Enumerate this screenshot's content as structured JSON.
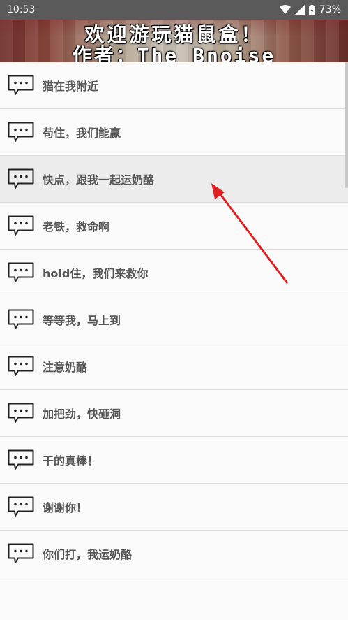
{
  "status_bar": {
    "time": "10:53",
    "battery": "73%",
    "icons": [
      "wifi-icon",
      "signal-icon",
      "battery-icon"
    ]
  },
  "banner": {
    "line1": "欢迎游玩猫鼠盒！",
    "line2": "作者：The_Bnoise"
  },
  "messages": [
    {
      "label": "猫在我附近",
      "icon": "message-icon"
    },
    {
      "label": "苟住，我们能赢",
      "icon": "message-icon"
    },
    {
      "label": "快点，跟我一起运奶酪",
      "icon": "message-icon"
    },
    {
      "label": "老铁，救命啊",
      "icon": "message-icon"
    },
    {
      "label": "hold住，我们来救你",
      "icon": "message-icon"
    },
    {
      "label": "等等我，马上到",
      "icon": "message-icon"
    },
    {
      "label": "注意奶酪",
      "icon": "message-icon"
    },
    {
      "label": "加把劲，快砸洞",
      "icon": "message-icon"
    },
    {
      "label": "干的真棒！",
      "icon": "message-icon"
    },
    {
      "label": "谢谢你！",
      "icon": "message-icon"
    },
    {
      "label": "你们打，我运奶酪",
      "icon": "message-icon"
    }
  ],
  "colors": {
    "status_bar": "#5a5a5a",
    "list_background": "#fafafa",
    "highlight": "#ececec",
    "arrow": "#e02020"
  }
}
